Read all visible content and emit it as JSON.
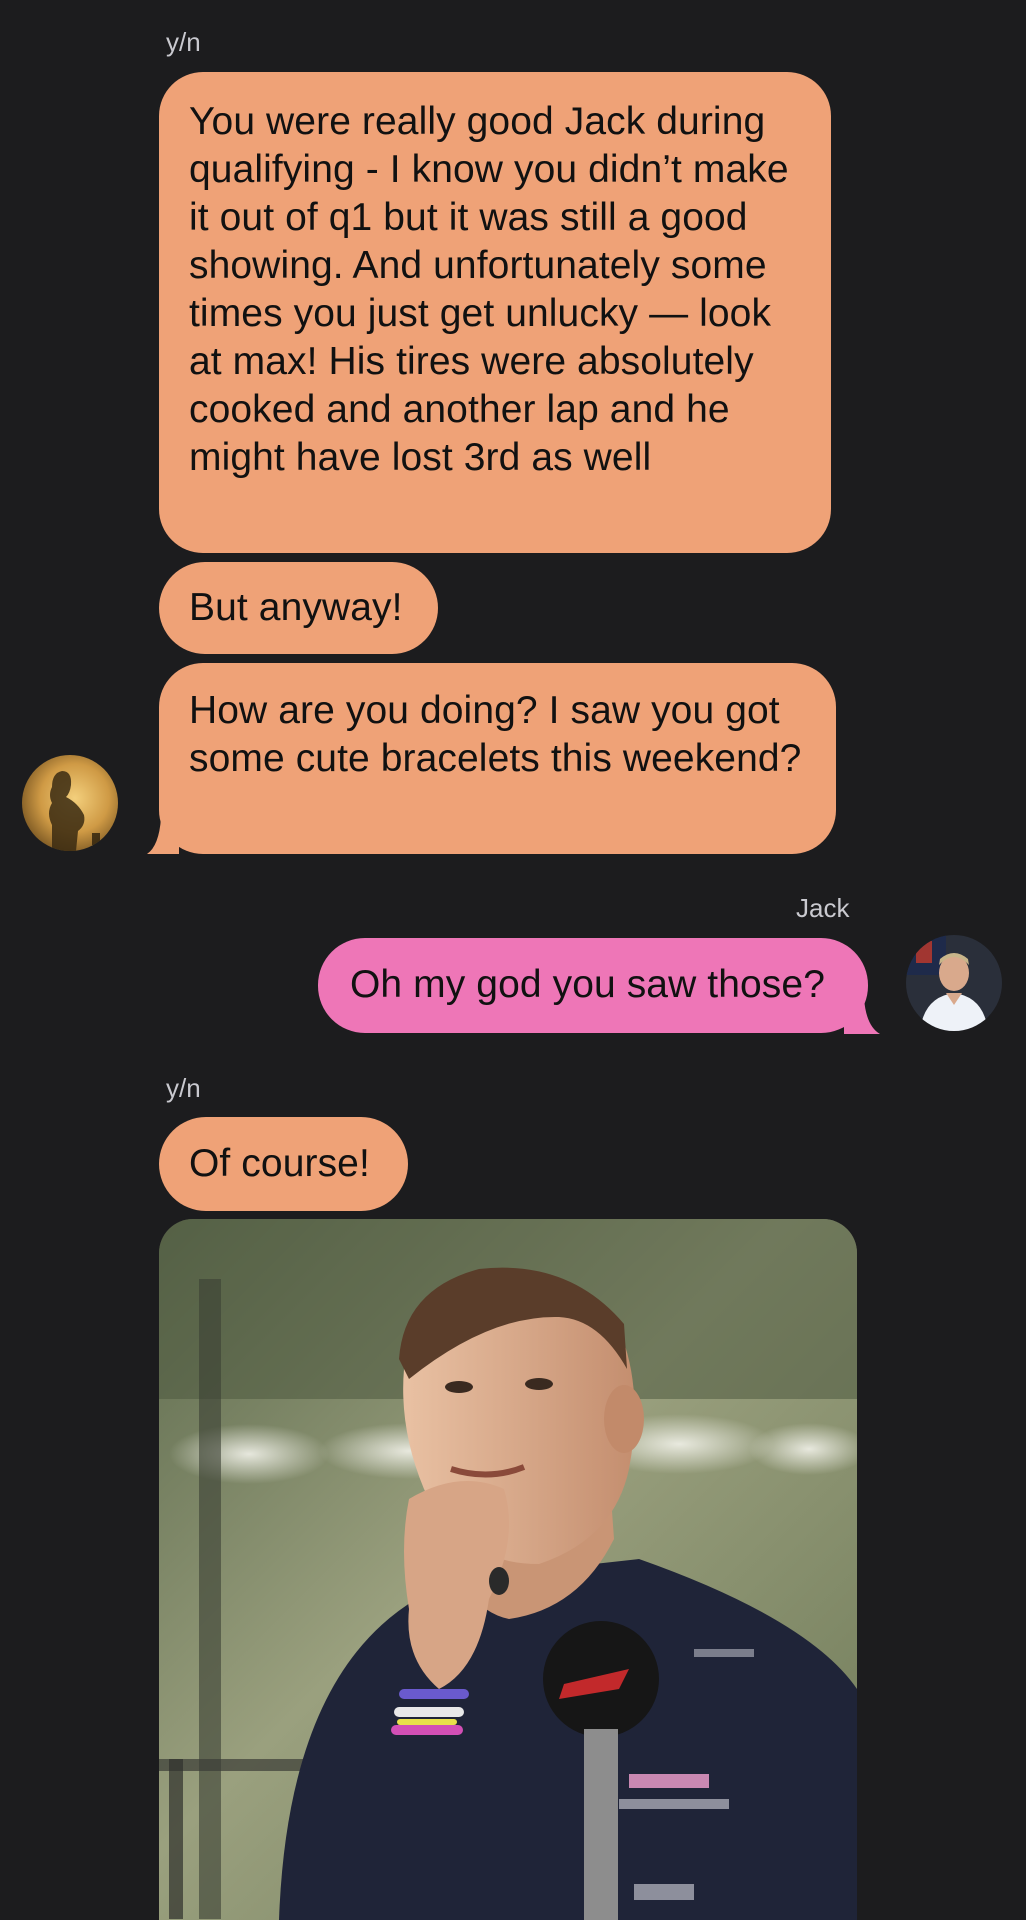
{
  "chat": {
    "contact_name": "y/n",
    "self_name": "Jack",
    "colors": {
      "background": "#1c1c1e",
      "incoming_bubble": "#efa277",
      "outgoing_bubble": "#ee76b7",
      "sender_name": "#c9c9cf"
    },
    "messages": [
      {
        "sender_label": "y/n",
        "text": "You were really good Jack during qualifying - I know you didn’t make it out of q1 but it was still a good showing. And unfortunately some times you just get unlucky — look at max! His tires were absolutely cooked and another lap and he might have lost 3rd as well"
      },
      {
        "text": "But anyway!"
      },
      {
        "text": "How are you doing? I saw you got some cute bracelets this weekend?"
      },
      {
        "sender_label": "Jack",
        "text": "Oh my god you saw those?"
      },
      {
        "sender_label": "y/n",
        "text": "Of course!"
      }
    ],
    "contact_avatar_icon": "silhouette-avatar-icon",
    "self_avatar_icon": "driver-avatar-icon",
    "attachment_icon": "photo-attachment-icon"
  }
}
